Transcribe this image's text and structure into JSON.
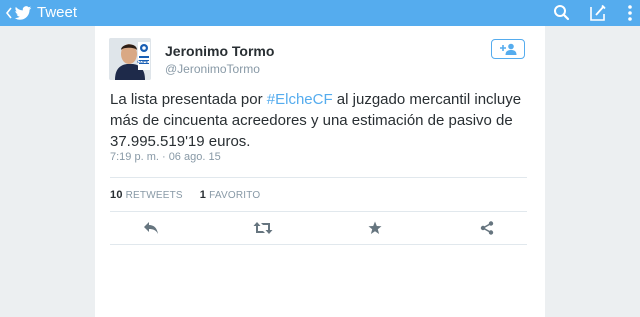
{
  "appbar": {
    "title": "Tweet",
    "icons": [
      "back-chevron-icon",
      "twitter-bird-icon",
      "search-icon",
      "compose-icon",
      "overflow-menu-icon"
    ]
  },
  "tweet": {
    "author_name": "Jeronimo Tormo",
    "author_handle": "@JeronimoTormo",
    "avatar_badge": "COPE",
    "text_before": "La lista presentada por ",
    "hashtag": "#ElcheCF",
    "text_after": " al juzgado mercantil incluye más de cincuenta acreedores y una estimación de pasivo de 37.995.519'19 euros.",
    "timestamp": "7:19 p. m. · 06 ago. 15",
    "retweets_count": "10",
    "retweets_label": "RETWEETS",
    "favorites_count": "1",
    "favorites_label": "FAVORITO"
  },
  "actions": [
    "reply-icon",
    "retweet-icon",
    "favorite-star-icon",
    "share-icon"
  ],
  "colors": {
    "brand": "#55acee",
    "text": "#292f33",
    "muted": "#8899a6",
    "icon": "#66757f",
    "background": "#eceff1"
  }
}
